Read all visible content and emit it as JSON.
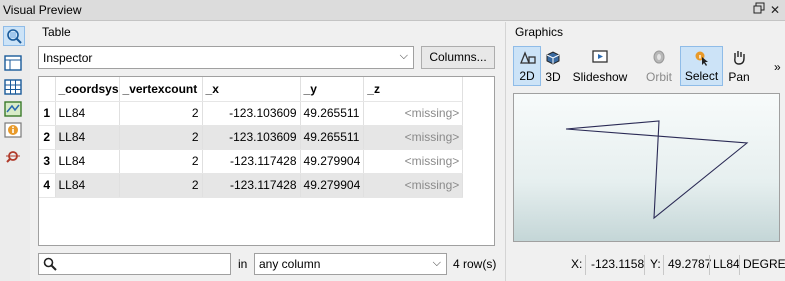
{
  "window": {
    "title": "Visual Preview",
    "float_icon": "float-icon",
    "close_icon": "close-icon"
  },
  "toolbar_icons": [
    "inspector-icon",
    "table-view-icon",
    "grid-icon",
    "map-view-icon",
    "info-icon",
    "settings-icon"
  ],
  "table_panel": {
    "label": "Table",
    "dataset_select": "Inspector",
    "columns_button": "Columns...",
    "headers": [
      "_coordsys",
      "_vertexcount",
      "_x",
      "_y",
      "_z"
    ],
    "rows": [
      {
        "n": "1",
        "coordsys": "LL84",
        "vertexcount": "2",
        "x": "-123.103609",
        "y": "49.265511",
        "z": "<missing>"
      },
      {
        "n": "2",
        "coordsys": "LL84",
        "vertexcount": "2",
        "x": "-123.103609",
        "y": "49.265511",
        "z": "<missing>"
      },
      {
        "n": "3",
        "coordsys": "LL84",
        "vertexcount": "2",
        "x": "-123.117428",
        "y": "49.279904",
        "z": "<missing>"
      },
      {
        "n": "4",
        "coordsys": "LL84",
        "vertexcount": "2",
        "x": "-123.117428",
        "y": "49.279904",
        "z": "<missing>"
      }
    ],
    "search": {
      "value": "",
      "in_label": "in",
      "column_select": "any column",
      "row_count": "4 row(s)"
    }
  },
  "graphics_panel": {
    "label": "Graphics",
    "tools": [
      {
        "label": "2D",
        "icon": "2d-icon",
        "active": true
      },
      {
        "label": "3D",
        "icon": "3d-icon",
        "active": false
      },
      {
        "label": "Slideshow",
        "icon": "slideshow-icon",
        "active": false
      },
      {
        "label": "Orbit",
        "icon": "orbit-icon",
        "active": false,
        "disabled": true
      },
      {
        "label": "Select",
        "icon": "select-icon",
        "active": true
      },
      {
        "label": "Pan",
        "icon": "pan-icon",
        "active": false
      }
    ],
    "overflow": "»",
    "status": {
      "x_label": "X:",
      "x_value": "-123.1158",
      "y_label": "Y:",
      "y_value": "49.2787",
      "coordsys": "LL84",
      "units": "DEGREE"
    }
  }
}
